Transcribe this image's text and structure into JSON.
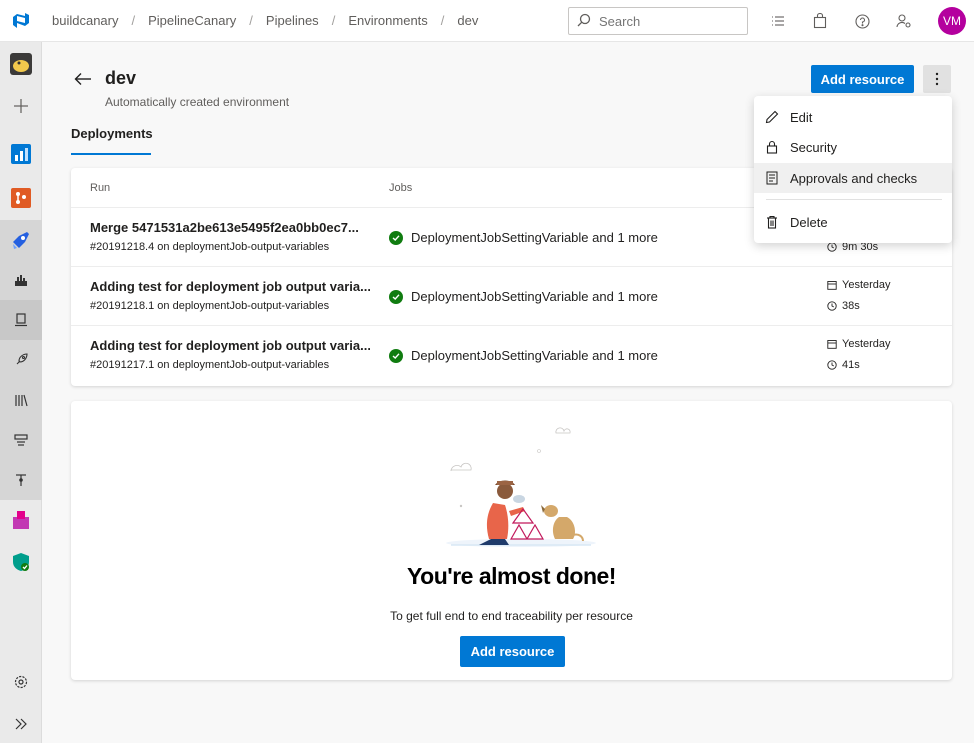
{
  "breadcrumb": [
    "buildcanary",
    "PipelineCanary",
    "Pipelines",
    "Environments",
    "dev"
  ],
  "search": {
    "placeholder": "Search"
  },
  "user": {
    "initials": "VM",
    "avatar_color": "#b4009e"
  },
  "page": {
    "title": "dev",
    "subtitle": "Automatically created environment",
    "add_resource_label": "Add resource"
  },
  "tabs": [
    {
      "label": "Deployments",
      "active": true
    }
  ],
  "table": {
    "headers": {
      "run": "Run",
      "jobs": "Jobs"
    },
    "rows": [
      {
        "title": "Merge 5471531a2be613e5495f2ea0bb0ec7...",
        "sub": "#20191218.4 on deploymentJob-output-variables",
        "job": "DeploymentJobSettingVariable and 1 more",
        "date": "",
        "duration": "9m 30s"
      },
      {
        "title": "Adding test for deployment job output varia...",
        "sub": "#20191218.1 on deploymentJob-output-variables",
        "job": "DeploymentJobSettingVariable and 1 more",
        "date": "Yesterday",
        "duration": "38s"
      },
      {
        "title": "Adding test for deployment job output varia...",
        "sub": "#20191217.1 on deploymentJob-output-variables",
        "job": "DeploymentJobSettingVariable and 1 more",
        "date": "Yesterday",
        "duration": "41s"
      }
    ]
  },
  "empty_state": {
    "title": "You're almost done!",
    "description": "To get full end to end traceability per resource",
    "button": "Add resource"
  },
  "menu": {
    "items": [
      "Edit",
      "Security",
      "Approvals and checks",
      "Delete"
    ],
    "hovered": "Approvals and checks"
  },
  "colors": {
    "accent": "#0078d4",
    "success": "#107c10"
  }
}
